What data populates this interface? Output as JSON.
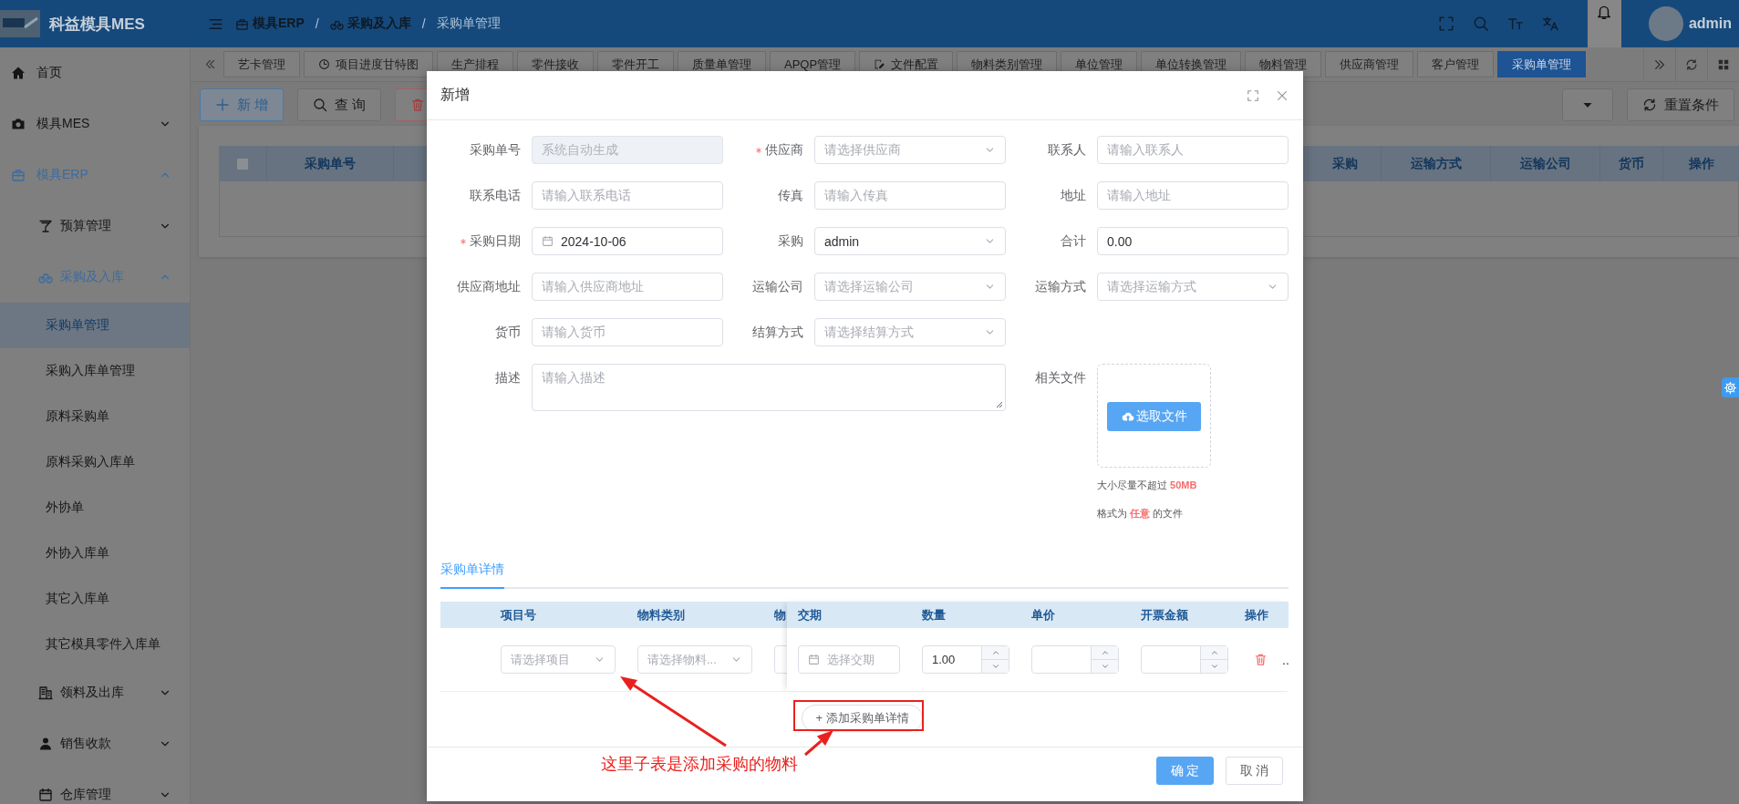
{
  "app": {
    "title": "科益模具MES"
  },
  "header": {
    "breadcrumb": [
      {
        "label": "模具ERP"
      },
      {
        "label": "采购及入库"
      },
      {
        "label": "采购单管理"
      }
    ],
    "separators": [
      "/",
      "/"
    ],
    "user": "admin"
  },
  "tabs": [
    {
      "label": "艺卡管理",
      "selected": false
    },
    {
      "label": "项目进度甘特图",
      "selected": false
    },
    {
      "label": "生产排程",
      "selected": false
    },
    {
      "label": "零件接收",
      "selected": false
    },
    {
      "label": "零件开工",
      "selected": false
    },
    {
      "label": "质量单管理",
      "selected": false
    },
    {
      "label": "APQP管理",
      "selected": false
    },
    {
      "label": "文件配置",
      "selected": false
    },
    {
      "label": "物料类别管理",
      "selected": false
    },
    {
      "label": "单位管理",
      "selected": false
    },
    {
      "label": "单位转换管理",
      "selected": false
    },
    {
      "label": "物料管理",
      "selected": false
    },
    {
      "label": "供应商管理",
      "selected": false
    },
    {
      "label": "客户管理",
      "selected": false
    },
    {
      "label": "采购单管理",
      "selected": true
    }
  ],
  "sidebar": {
    "items": [
      {
        "label": "首页",
        "active": false
      },
      {
        "label": "模具MES",
        "active": false,
        "expanded": false
      },
      {
        "label": "模具ERP",
        "active": true,
        "expanded": true,
        "children": [
          {
            "label": "预算管理",
            "active": false,
            "expanded": false
          },
          {
            "label": "采购及入库",
            "active": true,
            "expanded": true,
            "children": [
              {
                "label": "采购单管理",
                "selected": true
              },
              {
                "label": "采购入库单管理",
                "selected": false
              },
              {
                "label": "原料采购单",
                "selected": false
              },
              {
                "label": "原料采购入库单",
                "selected": false
              },
              {
                "label": "外协单",
                "selected": false
              },
              {
                "label": "外协入库单",
                "selected": false
              },
              {
                "label": "其它入库单",
                "selected": false
              },
              {
                "label": "其它模具零件入库单",
                "selected": false
              }
            ]
          },
          {
            "label": "领料及出库",
            "active": false,
            "expanded": false
          },
          {
            "label": "销售收款",
            "active": false,
            "expanded": false
          },
          {
            "label": "仓库管理",
            "active": false,
            "expanded": false
          }
        ]
      }
    ]
  },
  "toolbar": {
    "left": [
      {
        "kind": "add",
        "label": "新 增"
      },
      {
        "kind": "search",
        "label": "查 询"
      },
      {
        "kind": "delete"
      }
    ],
    "right": [
      {
        "kind": "dropdown"
      },
      {
        "kind": "reset",
        "label": "重置条件"
      }
    ]
  },
  "table": {
    "select_all": {
      "checked": false
    },
    "columns": [
      "采购单号",
      "采购",
      "运输方式",
      "运输公司",
      "货币",
      "操作"
    ]
  },
  "dialog": {
    "title": "新增",
    "fields": [
      {
        "label": "采购单号",
        "kind": "input",
        "placeholder": "系统自动生成",
        "required": false,
        "disabled": true
      },
      {
        "label": "供应商",
        "kind": "select",
        "placeholder": "请选择供应商",
        "required": true,
        "disabled": false
      },
      {
        "label": "联系人",
        "kind": "input",
        "placeholder": "请输入联系人",
        "required": false,
        "disabled": false
      },
      {
        "label": "联系电话",
        "kind": "input",
        "placeholder": "请输入联系电话",
        "required": false,
        "disabled": false
      },
      {
        "label": "传真",
        "kind": "input",
        "placeholder": "请输入传真",
        "required": false,
        "disabled": false
      },
      {
        "label": "地址",
        "kind": "input",
        "placeholder": "请输入地址",
        "required": false,
        "disabled": false
      },
      {
        "label": "采购日期",
        "kind": "date",
        "value": "2024-10-06",
        "required": true,
        "disabled": false
      },
      {
        "label": "采购",
        "kind": "select",
        "value": "admin",
        "required": false,
        "disabled": false
      },
      {
        "label": "合计",
        "kind": "input",
        "value": "0.00",
        "required": false,
        "disabled": false
      },
      {
        "label": "供应商地址",
        "kind": "input",
        "placeholder": "请输入供应商地址",
        "required": false,
        "disabled": false
      },
      {
        "label": "运输公司",
        "kind": "select",
        "placeholder": "请选择运输公司",
        "required": false,
        "disabled": false
      },
      {
        "label": "运输方式",
        "kind": "select",
        "placeholder": "请选择运输方式",
        "required": false,
        "disabled": false
      },
      {
        "label": "货币",
        "kind": "input",
        "placeholder": "请输入货币",
        "required": false,
        "disabled": false
      },
      {
        "label": "结算方式",
        "kind": "select",
        "placeholder": "请选择结算方式",
        "required": false,
        "disabled": false
      },
      {
        "label": "描述",
        "kind": "textarea",
        "placeholder": "请输入描述",
        "required": false,
        "disabled": false
      }
    ],
    "upload": {
      "label": "相关文件",
      "button": "选取文件",
      "hints": [
        "大小尽量不超过 **50MB**",
        "格式为 **任意** 的文件"
      ]
    },
    "detail": {
      "tabs": [
        {
          "label": "采购单详情",
          "selected": true
        }
      ],
      "columns": [
        {
          "label": "项目号",
          "cell": {
            "kind": "select",
            "placeholder": "请选择项目"
          }
        },
        {
          "label": "物料类别",
          "cell": {
            "kind": "select",
            "placeholder": "请选择物料..."
          }
        },
        {
          "label": "物",
          "cell": {
            "kind": "stub"
          }
        }
      ],
      "fixed_columns": [
        {
          "label": "交期",
          "cell": {
            "kind": "date",
            "placeholder": "选择交期"
          }
        },
        {
          "label": "数量",
          "cell": {
            "kind": "number",
            "value": "1.00"
          }
        },
        {
          "label": "单价",
          "cell": {
            "kind": "number"
          }
        },
        {
          "label": "开票金额",
          "cell": {
            "kind": "number"
          }
        },
        {
          "label": "操作",
          "cell": {
            "kind": "actions",
            "more": ".."
          }
        }
      ],
      "add_button": "+ 添加采购单详情"
    },
    "buttons": [
      {
        "kind": "primary",
        "label": "确 定"
      },
      {
        "kind": "default",
        "label": "取 消"
      }
    ]
  },
  "annotation": {
    "text": "这里子表是添加采购的物料"
  }
}
